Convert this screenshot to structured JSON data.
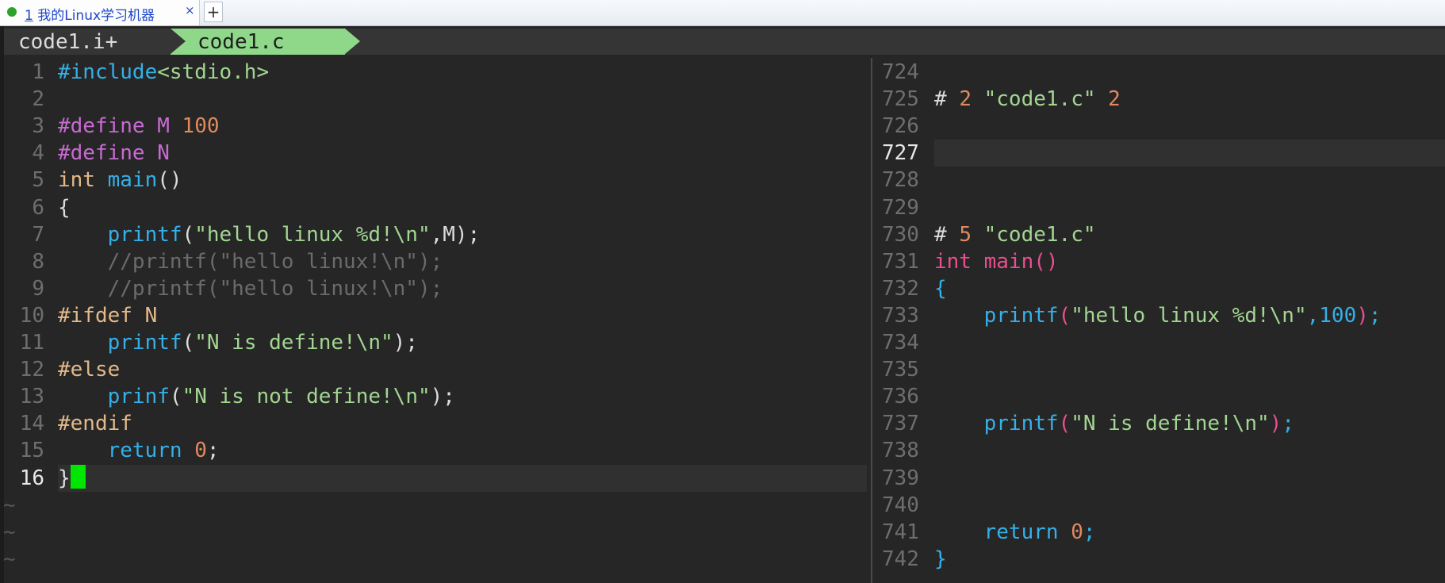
{
  "terminal": {
    "tab_number": "1",
    "tab_title": "我的Linux学习机器",
    "close_glyph": "×",
    "new_tab_glyph": "+"
  },
  "tabline": {
    "tab1_label": "code1.i+",
    "tab2_label": "code1.c"
  },
  "left_pane": {
    "lines": [
      {
        "n": "1",
        "parts": [
          [
            "blue",
            "#include"
          ],
          [
            "green",
            "<stdio.h>"
          ]
        ]
      },
      {
        "n": "2",
        "parts": []
      },
      {
        "n": "3",
        "parts": [
          [
            "magenta",
            "#define M "
          ],
          [
            "orange",
            "100"
          ]
        ]
      },
      {
        "n": "4",
        "parts": [
          [
            "magenta",
            "#define N"
          ]
        ]
      },
      {
        "n": "5",
        "parts": [
          [
            "tan",
            "int "
          ],
          [
            "blue",
            "main"
          ],
          [
            "white",
            "()"
          ]
        ]
      },
      {
        "n": "6",
        "parts": [
          [
            "white",
            "{"
          ]
        ]
      },
      {
        "n": "7",
        "parts": [
          [
            "white",
            "    "
          ],
          [
            "blue",
            "printf"
          ],
          [
            "white",
            "("
          ],
          [
            "green",
            "\"hello linux %d!\\n\""
          ],
          [
            "white",
            ",M);"
          ]
        ]
      },
      {
        "n": "8",
        "parts": [
          [
            "gray",
            "    //printf(\"hello linux!\\n\");"
          ]
        ]
      },
      {
        "n": "9",
        "parts": [
          [
            "gray",
            "    //printf(\"hello linux!\\n\");"
          ]
        ]
      },
      {
        "n": "10",
        "parts": [
          [
            "tan",
            "#ifdef N"
          ]
        ]
      },
      {
        "n": "11",
        "parts": [
          [
            "white",
            "    "
          ],
          [
            "blue",
            "printf"
          ],
          [
            "white",
            "("
          ],
          [
            "green",
            "\"N is define!\\n\""
          ],
          [
            "white",
            ");"
          ]
        ]
      },
      {
        "n": "12",
        "parts": [
          [
            "tan",
            "#else"
          ]
        ]
      },
      {
        "n": "13",
        "parts": [
          [
            "white",
            "    "
          ],
          [
            "blue",
            "prinf"
          ],
          [
            "white",
            "("
          ],
          [
            "green",
            "\"N is not define!\\n\""
          ],
          [
            "white",
            ");"
          ]
        ]
      },
      {
        "n": "14",
        "parts": [
          [
            "tan",
            "#endif"
          ]
        ]
      },
      {
        "n": "15",
        "parts": [
          [
            "white",
            "    "
          ],
          [
            "blue",
            "return "
          ],
          [
            "orange",
            "0"
          ],
          [
            "white",
            ";"
          ]
        ]
      },
      {
        "n": "16",
        "parts": [
          [
            "white",
            "}"
          ]
        ],
        "current": true,
        "cursor": true
      }
    ],
    "tildes": 3
  },
  "right_pane": {
    "lines": [
      {
        "n": "724",
        "parts": []
      },
      {
        "n": "725",
        "parts": [
          [
            "white",
            "# "
          ],
          [
            "orange",
            "2 "
          ],
          [
            "green",
            "\"code1.c\" "
          ],
          [
            "orange",
            "2"
          ]
        ]
      },
      {
        "n": "726",
        "parts": []
      },
      {
        "n": "727",
        "parts": [],
        "current": true
      },
      {
        "n": "728",
        "parts": []
      },
      {
        "n": "729",
        "parts": []
      },
      {
        "n": "730",
        "parts": [
          [
            "white",
            "# "
          ],
          [
            "orange",
            "5 "
          ],
          [
            "green",
            "\"code1.c\""
          ]
        ]
      },
      {
        "n": "731",
        "parts": [
          [
            "pink",
            "int main()"
          ]
        ]
      },
      {
        "n": "732",
        "parts": [
          [
            "blue",
            "{"
          ]
        ]
      },
      {
        "n": "733",
        "parts": [
          [
            "white",
            "    "
          ],
          [
            "blue",
            "printf"
          ],
          [
            "pink",
            "("
          ],
          [
            "green",
            "\"hello linux %d!\\n\""
          ],
          [
            "blue",
            ",100"
          ],
          [
            "pink",
            ")"
          ],
          [
            "blue",
            ";"
          ]
        ]
      },
      {
        "n": "734",
        "parts": []
      },
      {
        "n": "735",
        "parts": []
      },
      {
        "n": "736",
        "parts": []
      },
      {
        "n": "737",
        "parts": [
          [
            "white",
            "    "
          ],
          [
            "blue",
            "printf"
          ],
          [
            "pink",
            "("
          ],
          [
            "green",
            "\"N is define!\\n\""
          ],
          [
            "pink",
            ")"
          ],
          [
            "blue",
            ";"
          ]
        ]
      },
      {
        "n": "738",
        "parts": []
      },
      {
        "n": "739",
        "parts": []
      },
      {
        "n": "740",
        "parts": []
      },
      {
        "n": "741",
        "parts": [
          [
            "white",
            "    "
          ],
          [
            "blue",
            "return "
          ],
          [
            "orange",
            "0"
          ],
          [
            "blue",
            ";"
          ]
        ]
      },
      {
        "n": "742",
        "parts": [
          [
            "blue",
            "}"
          ]
        ]
      }
    ],
    "tilde_char": "~"
  },
  "colors": {
    "green_tab": "#8fd88a",
    "cursor": "#00e600",
    "keyword_blue": "#35b0e8",
    "string_green": "#a2d691",
    "number_orange": "#e1895f",
    "macro_magenta": "#c86ad2"
  }
}
